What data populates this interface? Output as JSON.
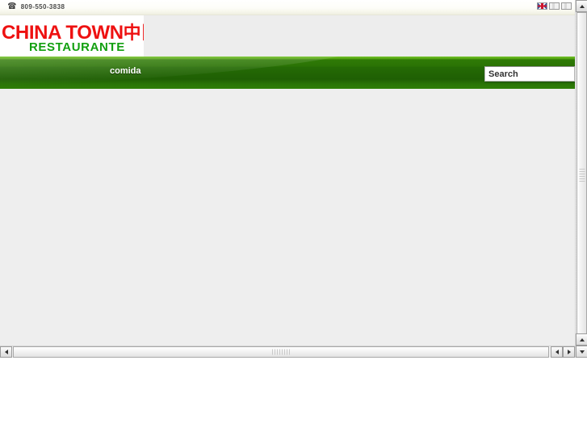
{
  "site": {
    "topbar": {
      "phone_icon": "phone-icon",
      "phone": "809-550-3838",
      "languages": [
        {
          "name": "flag-english",
          "code": "en"
        },
        {
          "name": "flag-blank-1",
          "code": ""
        },
        {
          "name": "flag-blank-2",
          "code": ""
        }
      ]
    },
    "logo": {
      "name_en": "CHINA TOWN",
      "name_cn": "中国城",
      "tagline": "RESTAURANTE",
      "color_red": "#ee1111",
      "color_green": "#12a010"
    },
    "nav": {
      "items": [
        {
          "label": "comida"
        }
      ],
      "accent": "#2b7305"
    },
    "search": {
      "value": "Search",
      "placeholder": "Search"
    },
    "content": {
      "body_text": "",
      "background": "#eeeeee"
    }
  },
  "chrome": {
    "vertical_scrollbar": {
      "up_icon": "arrow-up-icon",
      "down_icon": "arrow-down-icon",
      "extra_icon": "arrow-down-icon"
    },
    "horizontal_scrollbar": {
      "left_icon": "arrow-left-icon",
      "right_icon": "arrow-right-icon",
      "right_icon_2": "arrow-right-icon"
    }
  }
}
